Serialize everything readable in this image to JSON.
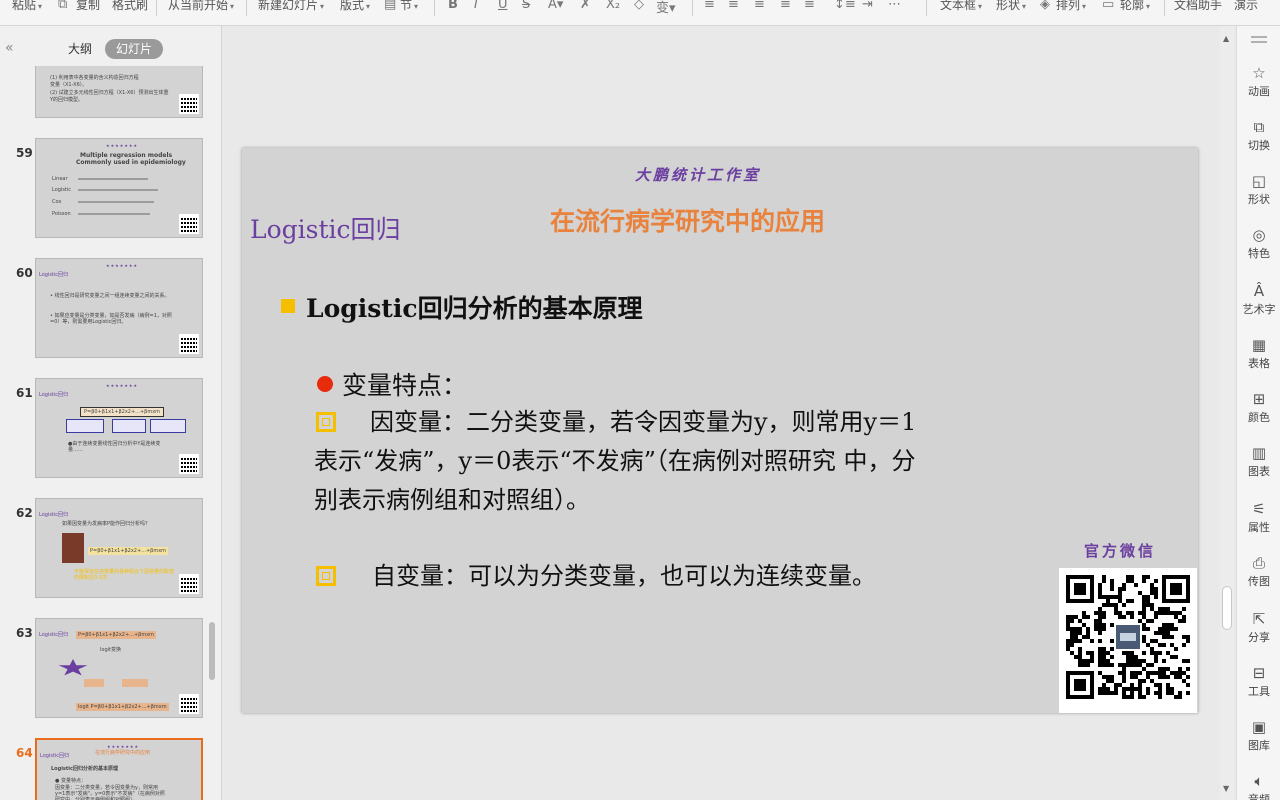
{
  "toolbar": {
    "paste": "粘贴",
    "copy": "复制",
    "format_painter": "格式刷",
    "from_current": "从当前开始",
    "new_slide": "新建幻灯片",
    "layout": "版式",
    "section": "节",
    "textbox": "文本框",
    "shape": "形状",
    "arrange": "排列",
    "outline": "轮廓",
    "doc_assistant": "文档助手",
    "present": "演示"
  },
  "left_panel": {
    "tabs": {
      "outline": "大纲",
      "slides": "幻灯片"
    },
    "thumbnails": [
      {
        "num": "",
        "lines": [
          "(1) 利用表中各变量的含义构造回归方程",
          "变量（X1-X6）。",
          "(2) 试建立多元线性回归方程（X1-X6）预测出生体重",
          "Y的回归模型。"
        ]
      },
      {
        "num": "59",
        "lines": [
          "Multiple regression models",
          "Commonly used in epidemiology",
          "Linear",
          "Logistic",
          "Cox",
          "Poisson"
        ]
      },
      {
        "num": "60",
        "lines": [
          "Logistic回归",
          "• 线性回归是研究变量之间一组连续变量之间的关系。",
          "• 如果应变量是分类变量，如是否发病（病例=1，对照=0）等，则需要用Logistic回归。"
        ]
      },
      {
        "num": "61",
        "lines": [
          "Logistic回归",
          "P=β0+β1x1+β2x2+...+βmxm",
          "●由于连续变量线性回归分析中Y是连续变量……"
        ]
      },
      {
        "num": "62",
        "lines": [
          "Logistic回归",
          "如果因变量为发病率P能作回归分析吗？",
          "P=β0+β1x1+β2x2+...+βmxm",
          "不能保证在自变量的各种组合下因变量的取值仍限制在0-1内"
        ]
      },
      {
        "num": "63",
        "lines": [
          "Logistic回归",
          "P=β0+β1x1+β2x2+...+βmxm",
          "logit变换",
          "logit P=β0+β1x1+β2x2+...+βmxm"
        ]
      },
      {
        "num": "64",
        "lines": [
          "Logistic回归",
          "在流行病学研究中的应用",
          "Logistic回归分析的基本原理",
          "● 变量特点：",
          "因变量：二分类变量，若令因变量为y，则常用y=1表示\"发病\"，y=0表示\"不发病\"（在病例对照研究中，分别表示病例组和对照组）。"
        ]
      }
    ]
  },
  "slide": {
    "studio": "大鹏统计工作室",
    "title": "Logistic回归",
    "subtitle": "在流行病学研究中的应用",
    "heading": "Logistic回归分析的基本原理",
    "var_label": "变量特点：",
    "dependent": "因变量：二分类变量，若令因变量为y，则常用y＝1表示“发病”，y＝0表示“不发病”（在病例对照研究 中，分别表示病例组和对照组）。",
    "independent": "自变量：可以为分类变量，也可以为连续变量。",
    "wechat": "官方微信"
  },
  "right_panel": {
    "items": [
      {
        "label": "动画",
        "icon": "animation-icon"
      },
      {
        "label": "切换",
        "icon": "transition-icon"
      },
      {
        "label": "形状",
        "icon": "shape-icon"
      },
      {
        "label": "特色",
        "icon": "feature-icon"
      },
      {
        "label": "艺术字",
        "icon": "wordart-icon"
      },
      {
        "label": "表格",
        "icon": "table-icon"
      },
      {
        "label": "颜色",
        "icon": "color-icon"
      },
      {
        "label": "图表",
        "icon": "chart-icon"
      },
      {
        "label": "属性",
        "icon": "properties-icon"
      },
      {
        "label": "传图",
        "icon": "upload-image-icon"
      },
      {
        "label": "分享",
        "icon": "share-icon"
      },
      {
        "label": "工具",
        "icon": "tools-icon"
      },
      {
        "label": "图库",
        "icon": "gallery-icon"
      },
      {
        "label": "音频",
        "icon": "audio-icon"
      }
    ]
  },
  "colors": {
    "purple": "#6b3fa0",
    "orange": "#e8823c",
    "bullet_yellow": "#f5bf00",
    "bullet_red": "#e72b0c",
    "active_thumb": "#e86c1c"
  }
}
